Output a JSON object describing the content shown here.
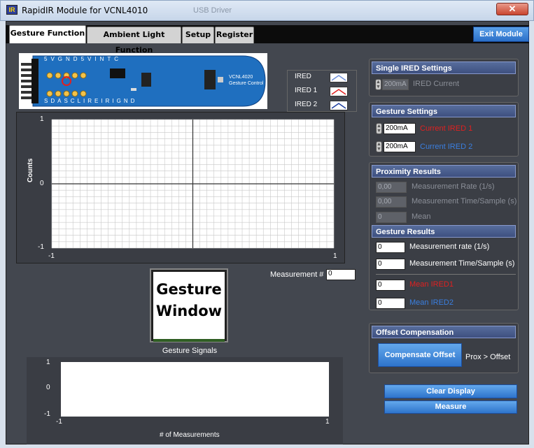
{
  "window": {
    "title": "RapidIR Module for VCNL4010",
    "ghost_title": "USB Driver",
    "close_glyph": "✕",
    "app_icon": "rapidir-app-icon"
  },
  "tabs": [
    {
      "label": "Gesture Function",
      "active": true
    },
    {
      "label": "Ambient Light Function",
      "active": false
    },
    {
      "label": "Setup",
      "active": false
    },
    {
      "label": "Register",
      "active": false
    }
  ],
  "exit_label": "Exit Module",
  "board": {
    "pins_top": [
      "5V",
      "GND",
      "5V",
      "INT",
      "C"
    ],
    "pins_bottom": [
      "SDA",
      "SCL",
      "IRE",
      "IRI",
      "GND"
    ],
    "chip_label": "VCNL4020 Gesture Control"
  },
  "legend": [
    {
      "label": "IRED",
      "color": "#6f8fd8"
    },
    {
      "label": "IRED 1",
      "color": "#e02020"
    },
    {
      "label": "IRED 2",
      "color": "#1f3f9f"
    }
  ],
  "main_chart": {
    "ylabel": "Counts",
    "y_ticks": [
      "1",
      "0",
      "-1"
    ],
    "x_ticks": [
      "-1",
      "1"
    ],
    "xlim": [
      -1,
      1
    ],
    "ylim": [
      -1,
      1
    ]
  },
  "gesture_window": {
    "line1": "Gesture",
    "line2": "Window"
  },
  "measurement": {
    "label": "Measurement #",
    "value": "0"
  },
  "bottom_chart": {
    "title": "Gesture Signals",
    "xlabel": "# of Measurements",
    "y_ticks": [
      "1",
      "0",
      "-1"
    ],
    "x_ticks": [
      "-1",
      "1"
    ]
  },
  "single_ired": {
    "header": "Single IRED Settings",
    "current_value": "200mA",
    "current_label": "IRED Current"
  },
  "gesture_settings": {
    "header": "Gesture Settings",
    "ired1_value": "200mA",
    "ired1_label": "Current IRED 1",
    "ired2_value": "200mA",
    "ired2_label": "Current IRED 2",
    "ired1_color": "#e02020",
    "ired2_color": "#3a7fe0"
  },
  "proximity": {
    "header": "Proximity Results",
    "rate_value": "0,00",
    "rate_label": "Measurement Rate (1/s)",
    "time_value": "0,00",
    "time_label": "Measurement Time/Sample (s)",
    "mean_value": "0",
    "mean_label": "Mean"
  },
  "gesture_results": {
    "header": "Gesture Results",
    "rate_value": "0",
    "rate_label": "Measurement rate  (1/s)",
    "time_value": "0",
    "time_label": "Measurement Time/Sample (s)",
    "mean1_value": "0",
    "mean1_label": "Mean IRED1",
    "mean2_value": "0",
    "mean2_label": "Mean IRED2"
  },
  "offset": {
    "header": "Offset Compensation",
    "button_label": "Compensate Offset",
    "status": "Prox > Offset"
  },
  "clear_label": "Clear Display",
  "measure_label": "Measure"
}
